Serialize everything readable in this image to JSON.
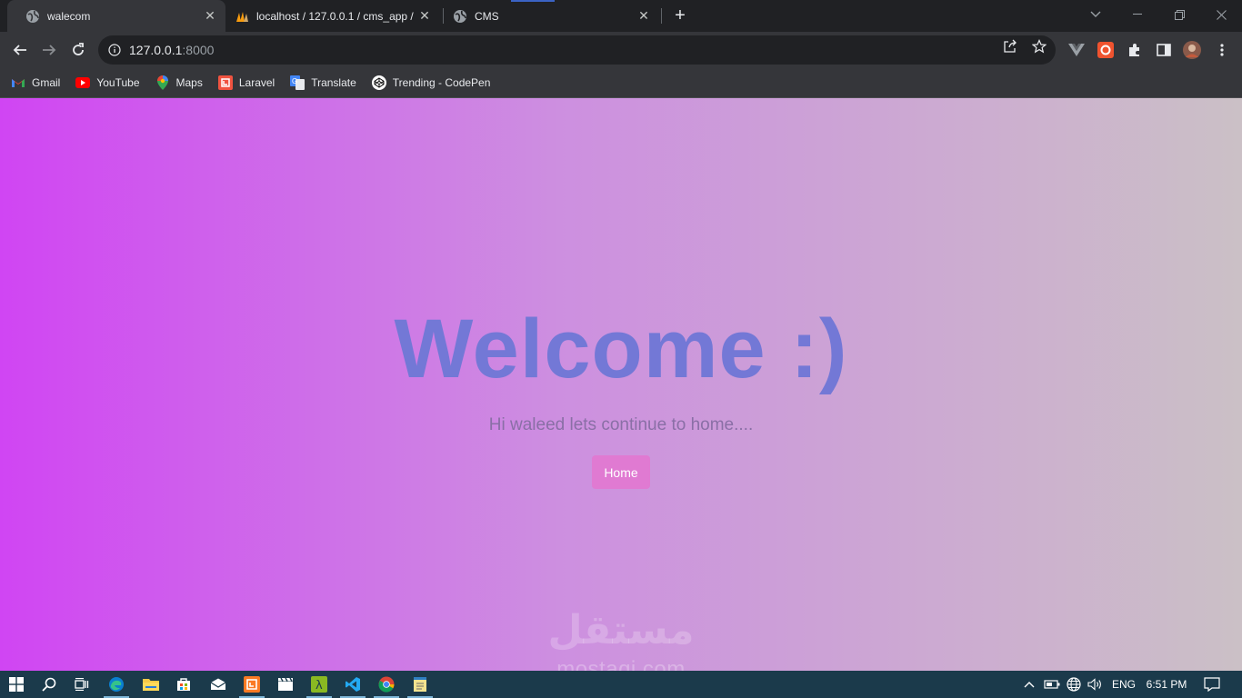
{
  "browser": {
    "tabs": [
      {
        "title": "walecom",
        "icon": "globe-icon",
        "active": true
      },
      {
        "title": "localhost / 127.0.0.1 / cms_app / ",
        "icon": "phpmyadmin-icon",
        "active": false
      },
      {
        "title": "CMS",
        "icon": "globe-icon",
        "active": false
      }
    ],
    "address": {
      "host": "127.0.0.1",
      "port": ":8000"
    },
    "bookmarks": [
      {
        "label": "Gmail",
        "icon": "gmail-icon",
        "color": "#ea4335"
      },
      {
        "label": "YouTube",
        "icon": "youtube-icon",
        "color": "#ff0000"
      },
      {
        "label": "Maps",
        "icon": "maps-icon",
        "color": "#34a853"
      },
      {
        "label": "Laravel",
        "icon": "laravel-icon",
        "color": "#f05340"
      },
      {
        "label": "Translate",
        "icon": "translate-icon",
        "color": "#4285f4"
      },
      {
        "label": "Trending - CodePen",
        "icon": "codepen-icon",
        "color": "#ffffff"
      }
    ]
  },
  "page": {
    "heading": "Welcome :)",
    "subtitle": "Hi waleed lets continue to home....",
    "home_button": "Home",
    "watermark_ar": "مستقل",
    "watermark": "mostaqi.com"
  },
  "taskbar": {
    "language": "ENG",
    "time": "6:51 PM"
  },
  "colors": {
    "gradient_start": "#d045f3",
    "gradient_end": "#cbc0c6",
    "heading": "#7378d6",
    "button": "#e07ad2"
  }
}
